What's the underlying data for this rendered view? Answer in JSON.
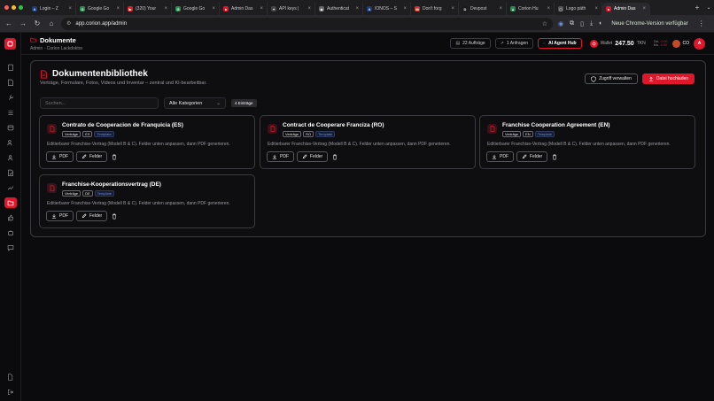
{
  "browser": {
    "tabs": [
      {
        "title": "Login – Z",
        "color": "#1f3b7a",
        "glyph": "Λ"
      },
      {
        "title": "Google Go",
        "color": "#2d8a4e",
        "glyph": "G"
      },
      {
        "title": "(320) Your",
        "color": "#e02020",
        "glyph": "▶"
      },
      {
        "title": "Google Go",
        "color": "#2d8a4e",
        "glyph": "G"
      },
      {
        "title": "Admin Das",
        "color": "#e0162b",
        "glyph": "●"
      },
      {
        "title": "API keys |",
        "color": "#444",
        "glyph": "✦"
      },
      {
        "title": "Authenticat",
        "color": "#666",
        "glyph": "◉"
      },
      {
        "title": "IONOS – S",
        "color": "#1f3b7a",
        "glyph": "Λ"
      },
      {
        "title": "Don't forg",
        "color": "#c0392b",
        "glyph": "M"
      },
      {
        "title": "Devpost",
        "color": "#1a1a1a",
        "glyph": "D"
      },
      {
        "title": "Corion Hu",
        "color": "#2d8a4e",
        "glyph": "▲"
      },
      {
        "title": "Logo päth",
        "color": "#555",
        "glyph": "◻"
      },
      {
        "title": "Admin Das",
        "color": "#e0162b",
        "glyph": "●"
      }
    ],
    "url": "app.corion.app/admin",
    "update_label": "Neue Chrome-Version verfügbar"
  },
  "header": {
    "title": "Dokumente",
    "breadcrumb": "Admin · Corion Lackdoktor",
    "orders_label": "22 Aufträge",
    "requests_label": "1 Anfragen",
    "agent_label": "AI Agent Hub",
    "credits_prefix": "Wallet",
    "credits_amount": "247.50",
    "credits_unit": "TKN",
    "stat1_label": "Gst.",
    "stat1_value": "-0.00",
    "stat2_label": "Ma.",
    "stat2_value": "-0.00",
    "user_initials": "CO",
    "badge": "A"
  },
  "library": {
    "title": "Dokumentenbibliothek",
    "subtitle": "Verträge, Formulare, Fotos, Videos und Inventar – zentral und KI-bearbeitbar.",
    "access_button": "Zugriff verwalten",
    "upload_button": "Datei hochladen",
    "search_placeholder": "Suchen...",
    "category_select": "Alle Kategorien",
    "count_label": "4 Einträge",
    "cards": [
      {
        "title": "Contrato de Cooperacion de Franquicia (ES)",
        "tags": [
          "Verträge",
          "ES",
          "Template"
        ],
        "desc": "Editierbarer Franchise-Vertrag (Modell B & C). Felder unten anpassen, dann PDF generieren.",
        "pdf": "PDF",
        "fields": "Felder"
      },
      {
        "title": "Contract de Cooperare Franciza (RO)",
        "tags": [
          "Verträge",
          "RO",
          "Template"
        ],
        "desc": "Editierbarer Franchise-Vertrag (Modell B & C). Felder unten anpassen, dann PDF generieren.",
        "pdf": "PDF",
        "fields": "Felder"
      },
      {
        "title": "Franchise Cooperation Agreement (EN)",
        "tags": [
          "Verträge",
          "EN",
          "Template"
        ],
        "desc": "Editierbarer Franchise-Vertrag (Modell B & C). Felder unten anpassen, dann PDF generieren.",
        "pdf": "PDF",
        "fields": "Felder"
      },
      {
        "title": "Franchise-Kooperationsvertrag (DE)",
        "tags": [
          "Verträge",
          "DE",
          "Template"
        ],
        "desc": "Editierbarer Franchise-Vertrag (Modell B & C). Felder unten anpassen, dann PDF generieren.",
        "pdf": "PDF",
        "fields": "Felder"
      }
    ]
  },
  "colors": {
    "accent": "#e0162b",
    "template_tag": "#6f8fe0"
  }
}
